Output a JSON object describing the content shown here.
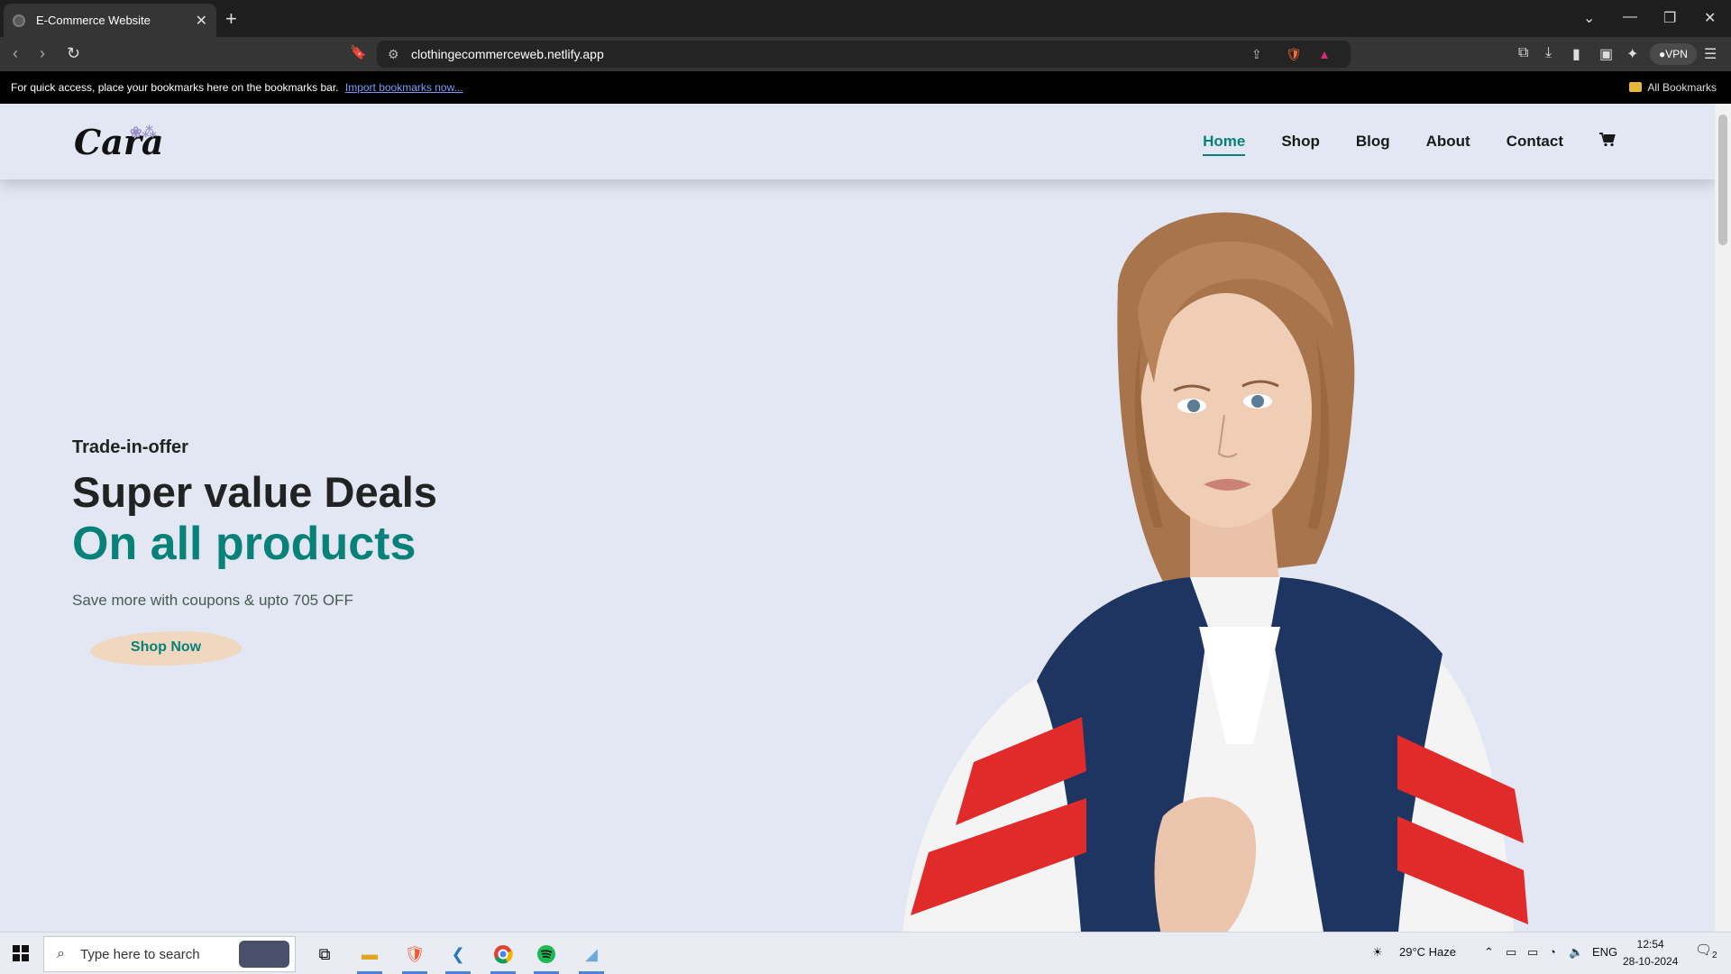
{
  "browser": {
    "tab_title": "E-Commerce Website",
    "url": "clothingecommerceweb.netlify.app",
    "vpn_label": "VPN",
    "bookmarks_message": "For quick access, place your bookmarks here on the bookmarks bar.",
    "bookmarks_link": "Import bookmarks now...",
    "all_bookmarks": "All Bookmarks"
  },
  "site": {
    "logo": "Cara",
    "nav": [
      {
        "label": "Home",
        "active": true
      },
      {
        "label": "Shop"
      },
      {
        "label": "Blog"
      },
      {
        "label": "About"
      },
      {
        "label": "Contact"
      }
    ],
    "cart_icon": "cart-icon"
  },
  "hero": {
    "kicker": "Trade-in-offer",
    "headline": "Super value Deals",
    "highlight": "On all products",
    "subtext": "Save more with coupons & upto 705 OFF",
    "cta": "Shop Now"
  },
  "taskbar": {
    "search_placeholder": "Type here to search",
    "weather": "29°C  Haze",
    "language": "ENG",
    "time": "12:54",
    "date": "28-10-2024",
    "notification_count": "2"
  },
  "colors": {
    "accent": "#088178",
    "page_bg": "#e3e6f3",
    "cta_bg": "#efd8bf"
  }
}
